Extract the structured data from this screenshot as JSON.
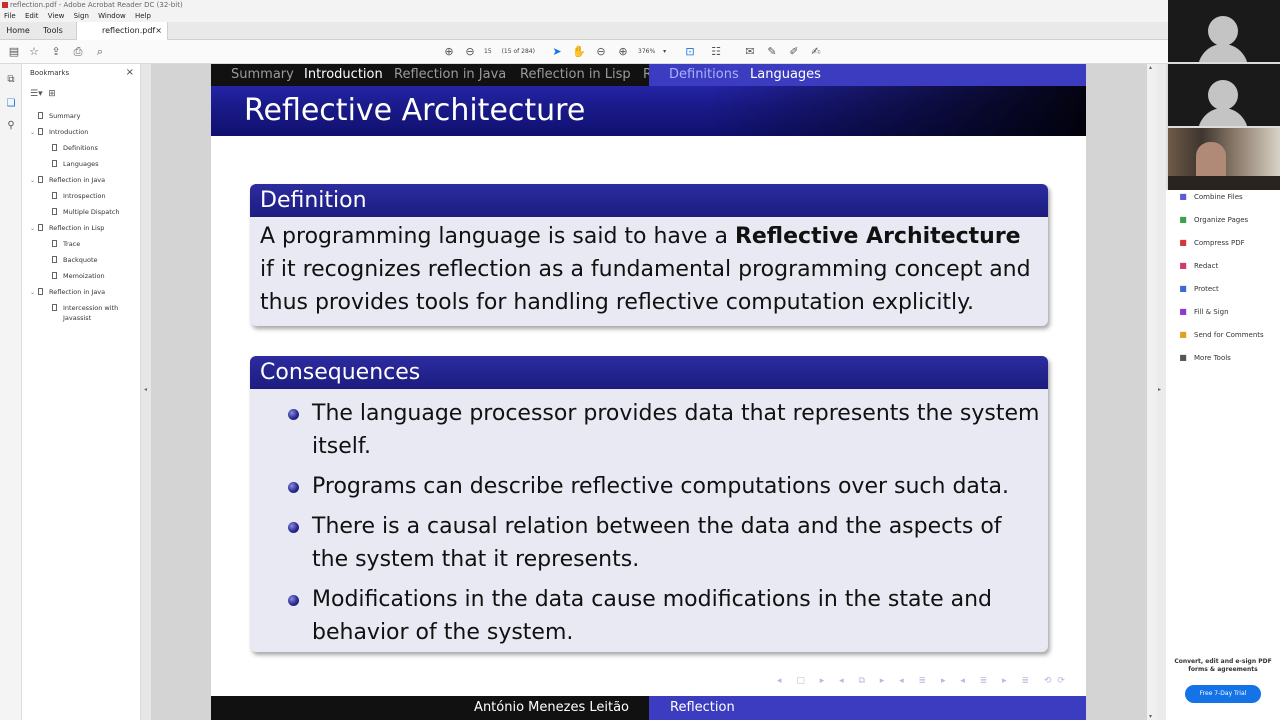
{
  "app": {
    "window_title": "reflection.pdf - Adobe Acrobat Reader DC (32-bit)",
    "menu": [
      "File",
      "Edit",
      "View",
      "Sign",
      "Window",
      "Help"
    ],
    "tabs": {
      "home": "Home",
      "tools": "Tools",
      "document": "reflection.pdf",
      "close": "×"
    }
  },
  "toolbar": {
    "page_number": "15",
    "page_of": "(15 of 284)",
    "zoom": "376%"
  },
  "bookmarks": {
    "title": "Bookmarks",
    "close": "×",
    "items": [
      {
        "label": "Summary",
        "level": 0
      },
      {
        "label": "Introduction",
        "level": 0
      },
      {
        "label": "Definitions",
        "level": 1
      },
      {
        "label": "Languages",
        "level": 1
      },
      {
        "label": "Reflection in Java",
        "level": 0
      },
      {
        "label": "Introspection",
        "level": 1
      },
      {
        "label": "Multiple Dispatch",
        "level": 1
      },
      {
        "label": "Reflection in Lisp",
        "level": 0
      },
      {
        "label": "Trace",
        "level": 1
      },
      {
        "label": "Backquote",
        "level": 1
      },
      {
        "label": "Memoization",
        "level": 1
      },
      {
        "label": "Reflection in Java",
        "level": 0
      },
      {
        "label": "Intercession with",
        "level": 1
      },
      {
        "label": "Javassist",
        "level": 1
      }
    ]
  },
  "tools_panel": {
    "items": [
      {
        "label": "Combine Files",
        "icon": "combine-icon",
        "color": "#5b5bd6"
      },
      {
        "label": "Organize Pages",
        "icon": "organize-icon",
        "color": "#3aa34a"
      },
      {
        "label": "Compress PDF",
        "icon": "compress-icon",
        "color": "#d23a3a"
      },
      {
        "label": "Redact",
        "icon": "redact-icon",
        "color": "#d23a6a"
      },
      {
        "label": "Protect",
        "icon": "protect-icon",
        "color": "#3a6ad2"
      },
      {
        "label": "Fill & Sign",
        "icon": "fill-sign-icon",
        "color": "#8a3ad2"
      },
      {
        "label": "Send for Comments",
        "icon": "comments-icon",
        "color": "#e0a020"
      },
      {
        "label": "More Tools",
        "icon": "more-tools-icon",
        "color": "#555555"
      }
    ],
    "promo_line1": "Convert, edit and e-sign PDF",
    "promo_line2": "forms & agreements",
    "trial_button": "Free 7-Day Trial"
  },
  "slide": {
    "nav_left": [
      "Summary",
      "Introduction",
      "Reflection in Java",
      "Reflection in Lisp",
      "R"
    ],
    "nav_left_current": "Introduction",
    "nav_right": [
      "Definitions",
      "Languages"
    ],
    "nav_right_current": "Languages",
    "title": "Reflective Architecture",
    "definition": {
      "heading": "Definition",
      "text_before": "A programming language is said to have a ",
      "text_bold": "Reflective Architecture",
      "text_after": " if it recognizes reflection as a fundamental programming concept and thus provides tools for handling reflective computation explicitly."
    },
    "consequences": {
      "heading": "Consequences",
      "bullets": [
        "The language processor provides data that represents the system itself.",
        "Programs can describe reflective computations over such data.",
        "There is a causal relation between the data and the aspects of the system that it represents.",
        "Modifications in the data cause modifications in the state and behavior of the system."
      ]
    },
    "footer_author": "António Menezes Leitão",
    "footer_title": "Reflection",
    "beamer_nav": "◂ ▢ ▸ ◂ ⧉ ▸ ◂ ≣ ▸ ◂ ≣ ▸ ≣ ⟲⟳"
  },
  "colors": {
    "beamer_blue": "#3c3cc0",
    "beamer_dark": "#111111",
    "block_bg": "#e9e9f4",
    "acrobat_accent": "#1473e6"
  }
}
